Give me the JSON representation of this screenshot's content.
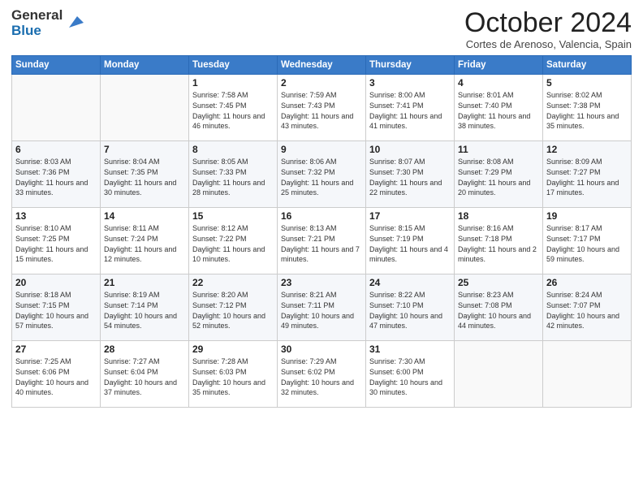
{
  "header": {
    "title": "October 2024",
    "subtitle": "Cortes de Arenoso, Valencia, Spain"
  },
  "days": [
    "Sunday",
    "Monday",
    "Tuesday",
    "Wednesday",
    "Thursday",
    "Friday",
    "Saturday"
  ],
  "weeks": [
    [
      {
        "day": "",
        "detail": ""
      },
      {
        "day": "",
        "detail": ""
      },
      {
        "day": "1",
        "detail": "Sunrise: 7:58 AM\nSunset: 7:45 PM\nDaylight: 11 hours and 46 minutes."
      },
      {
        "day": "2",
        "detail": "Sunrise: 7:59 AM\nSunset: 7:43 PM\nDaylight: 11 hours and 43 minutes."
      },
      {
        "day": "3",
        "detail": "Sunrise: 8:00 AM\nSunset: 7:41 PM\nDaylight: 11 hours and 41 minutes."
      },
      {
        "day": "4",
        "detail": "Sunrise: 8:01 AM\nSunset: 7:40 PM\nDaylight: 11 hours and 38 minutes."
      },
      {
        "day": "5",
        "detail": "Sunrise: 8:02 AM\nSunset: 7:38 PM\nDaylight: 11 hours and 35 minutes."
      }
    ],
    [
      {
        "day": "6",
        "detail": "Sunrise: 8:03 AM\nSunset: 7:36 PM\nDaylight: 11 hours and 33 minutes."
      },
      {
        "day": "7",
        "detail": "Sunrise: 8:04 AM\nSunset: 7:35 PM\nDaylight: 11 hours and 30 minutes."
      },
      {
        "day": "8",
        "detail": "Sunrise: 8:05 AM\nSunset: 7:33 PM\nDaylight: 11 hours and 28 minutes."
      },
      {
        "day": "9",
        "detail": "Sunrise: 8:06 AM\nSunset: 7:32 PM\nDaylight: 11 hours and 25 minutes."
      },
      {
        "day": "10",
        "detail": "Sunrise: 8:07 AM\nSunset: 7:30 PM\nDaylight: 11 hours and 22 minutes."
      },
      {
        "day": "11",
        "detail": "Sunrise: 8:08 AM\nSunset: 7:29 PM\nDaylight: 11 hours and 20 minutes."
      },
      {
        "day": "12",
        "detail": "Sunrise: 8:09 AM\nSunset: 7:27 PM\nDaylight: 11 hours and 17 minutes."
      }
    ],
    [
      {
        "day": "13",
        "detail": "Sunrise: 8:10 AM\nSunset: 7:25 PM\nDaylight: 11 hours and 15 minutes."
      },
      {
        "day": "14",
        "detail": "Sunrise: 8:11 AM\nSunset: 7:24 PM\nDaylight: 11 hours and 12 minutes."
      },
      {
        "day": "15",
        "detail": "Sunrise: 8:12 AM\nSunset: 7:22 PM\nDaylight: 11 hours and 10 minutes."
      },
      {
        "day": "16",
        "detail": "Sunrise: 8:13 AM\nSunset: 7:21 PM\nDaylight: 11 hours and 7 minutes."
      },
      {
        "day": "17",
        "detail": "Sunrise: 8:15 AM\nSunset: 7:19 PM\nDaylight: 11 hours and 4 minutes."
      },
      {
        "day": "18",
        "detail": "Sunrise: 8:16 AM\nSunset: 7:18 PM\nDaylight: 11 hours and 2 minutes."
      },
      {
        "day": "19",
        "detail": "Sunrise: 8:17 AM\nSunset: 7:17 PM\nDaylight: 10 hours and 59 minutes."
      }
    ],
    [
      {
        "day": "20",
        "detail": "Sunrise: 8:18 AM\nSunset: 7:15 PM\nDaylight: 10 hours and 57 minutes."
      },
      {
        "day": "21",
        "detail": "Sunrise: 8:19 AM\nSunset: 7:14 PM\nDaylight: 10 hours and 54 minutes."
      },
      {
        "day": "22",
        "detail": "Sunrise: 8:20 AM\nSunset: 7:12 PM\nDaylight: 10 hours and 52 minutes."
      },
      {
        "day": "23",
        "detail": "Sunrise: 8:21 AM\nSunset: 7:11 PM\nDaylight: 10 hours and 49 minutes."
      },
      {
        "day": "24",
        "detail": "Sunrise: 8:22 AM\nSunset: 7:10 PM\nDaylight: 10 hours and 47 minutes."
      },
      {
        "day": "25",
        "detail": "Sunrise: 8:23 AM\nSunset: 7:08 PM\nDaylight: 10 hours and 44 minutes."
      },
      {
        "day": "26",
        "detail": "Sunrise: 8:24 AM\nSunset: 7:07 PM\nDaylight: 10 hours and 42 minutes."
      }
    ],
    [
      {
        "day": "27",
        "detail": "Sunrise: 7:25 AM\nSunset: 6:06 PM\nDaylight: 10 hours and 40 minutes."
      },
      {
        "day": "28",
        "detail": "Sunrise: 7:27 AM\nSunset: 6:04 PM\nDaylight: 10 hours and 37 minutes."
      },
      {
        "day": "29",
        "detail": "Sunrise: 7:28 AM\nSunset: 6:03 PM\nDaylight: 10 hours and 35 minutes."
      },
      {
        "day": "30",
        "detail": "Sunrise: 7:29 AM\nSunset: 6:02 PM\nDaylight: 10 hours and 32 minutes."
      },
      {
        "day": "31",
        "detail": "Sunrise: 7:30 AM\nSunset: 6:00 PM\nDaylight: 10 hours and 30 minutes."
      },
      {
        "day": "",
        "detail": ""
      },
      {
        "day": "",
        "detail": ""
      }
    ]
  ]
}
